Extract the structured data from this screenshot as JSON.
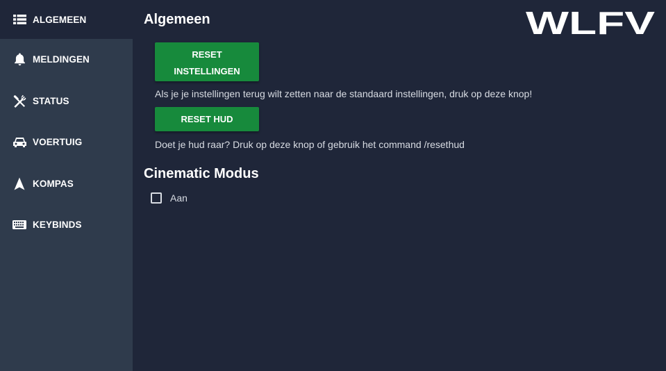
{
  "sidebar": {
    "items": [
      {
        "label": "ALGEMEEN",
        "icon": "list-icon",
        "active": true
      },
      {
        "label": "MELDINGEN",
        "icon": "bell-icon",
        "active": false
      },
      {
        "label": "STATUS",
        "icon": "fork-knife-icon",
        "active": false
      },
      {
        "label": "VOERTUIG",
        "icon": "car-icon",
        "active": false
      },
      {
        "label": "KOMPAS",
        "icon": "navigation-arrow-icon",
        "active": false
      },
      {
        "label": "KEYBINDS",
        "icon": "keyboard-icon",
        "active": false
      }
    ]
  },
  "main": {
    "general": {
      "title": "Algemeen",
      "reset_settings_label_line1": "RESET",
      "reset_settings_label_line2": "INSTELLINGEN",
      "reset_settings_hint": "Als je je instellingen terug wilt zetten naar de standaard instellingen, druk op deze knop!",
      "reset_hud_label": "RESET HUD",
      "reset_hud_hint": "Doet je hud raar? Druk op deze knop of gebruik het command /resethud"
    },
    "cinematic": {
      "title": "Cinematic Modus",
      "toggle_label": "Aan",
      "checked": false
    }
  },
  "logo": {
    "text": "WLFV"
  },
  "colors": {
    "background": "#1f2639",
    "sidebar": "#2f3b4c",
    "button": "#178a3c",
    "text": "#ffffff",
    "muted_text": "#d8dce3"
  }
}
